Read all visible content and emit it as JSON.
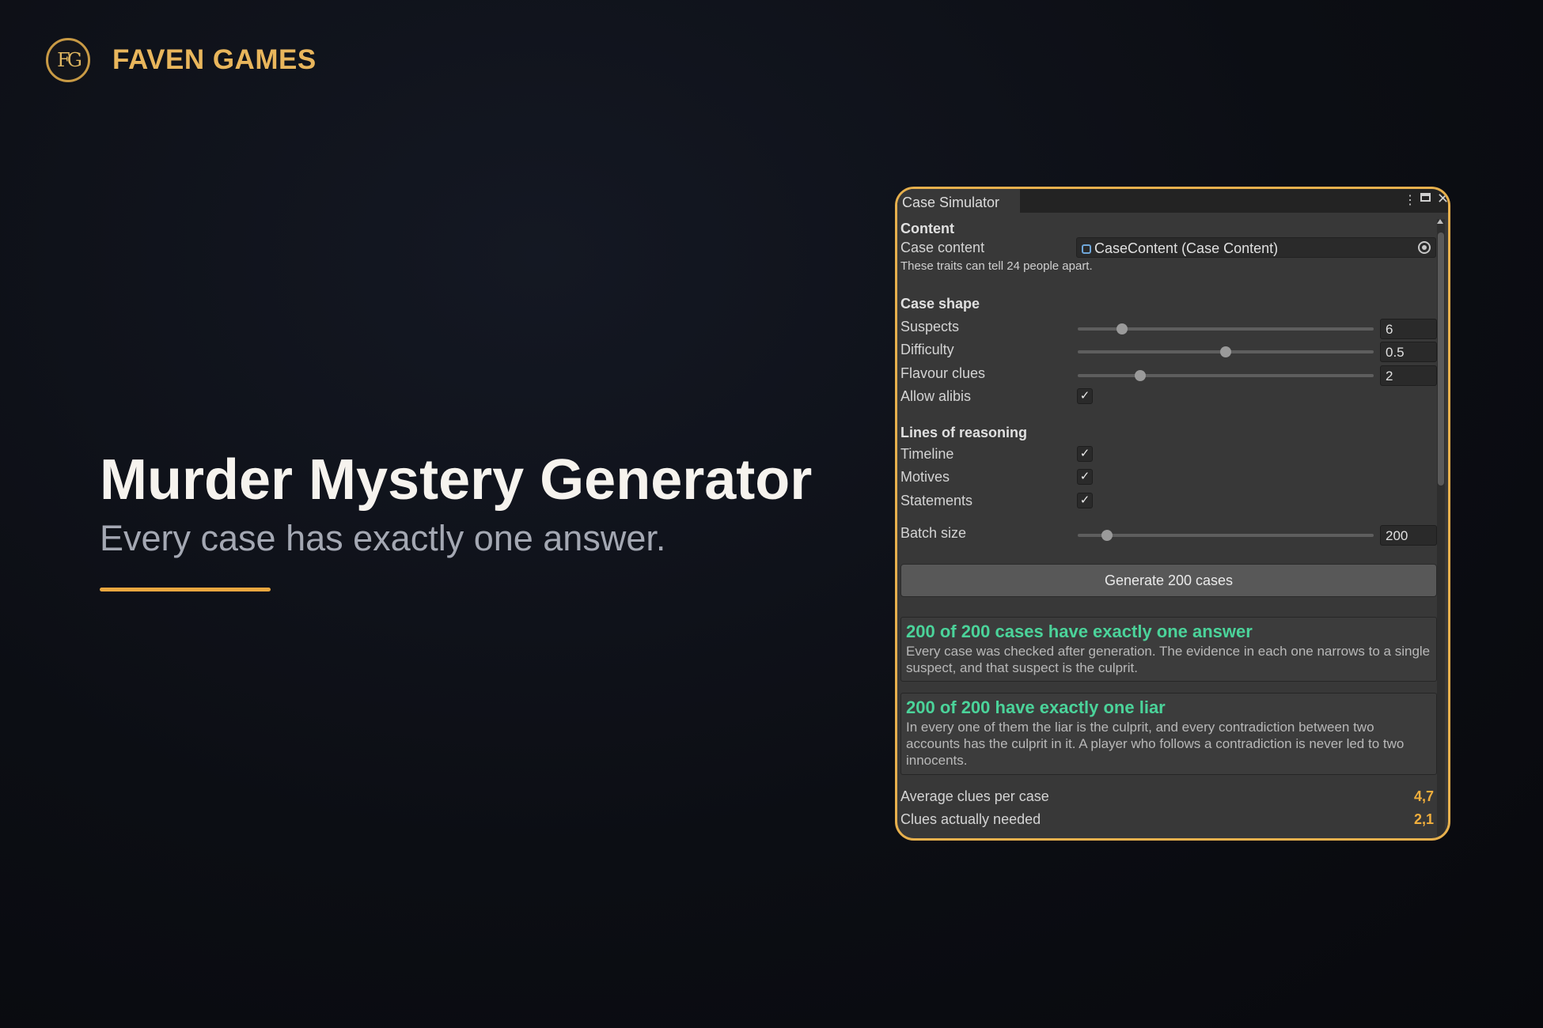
{
  "brand": {
    "logo_text": "FG",
    "name": "FAVEN GAMES"
  },
  "hero": {
    "title": "Murder Mystery Generator",
    "subtitle": "Every case has exactly one answer."
  },
  "window": {
    "tab": "Case Simulator",
    "content_section": "Content",
    "case_content_label": "Case content",
    "case_content_value": "CaseContent (Case Content)",
    "traits_note": "These traits can tell 24 people apart.",
    "shape_section": "Case shape",
    "suspects": {
      "label": "Suspects",
      "value": "6",
      "fraction": 0.15
    },
    "difficulty": {
      "label": "Difficulty",
      "value": "0.5",
      "fraction": 0.5
    },
    "flavour": {
      "label": "Flavour clues",
      "value": "2",
      "fraction": 0.21
    },
    "alibis": {
      "label": "Allow alibis",
      "checked": true
    },
    "reasoning_section": "Lines of reasoning",
    "timeline": {
      "label": "Timeline",
      "checked": true
    },
    "motives": {
      "label": "Motives",
      "checked": true
    },
    "statements": {
      "label": "Statements",
      "checked": true
    },
    "batch": {
      "label": "Batch size",
      "value": "200",
      "fraction": 0.1
    },
    "generate_label": "Generate 200 cases",
    "result1": {
      "title": "200 of 200 cases have exactly one answer",
      "body": "Every case was checked after generation. The evidence in each one narrows to a single suspect, and that suspect is the culprit."
    },
    "result2": {
      "title": "200 of 200 have exactly one liar",
      "body": "In every one of them the liar is the culprit, and every contradiction between two accounts has the culprit in it. A player who follows a contradiction is never led to two innocents."
    },
    "stats": [
      {
        "label": "Average clues per case",
        "value": "4,7"
      },
      {
        "label": "Clues actually needed",
        "value": "2,1"
      }
    ]
  },
  "colors": {
    "accent": "#e9b65c",
    "panel_border": "#e7b04d",
    "success_text": "#4bd39a",
    "stat_value": "#f0ae3c"
  }
}
